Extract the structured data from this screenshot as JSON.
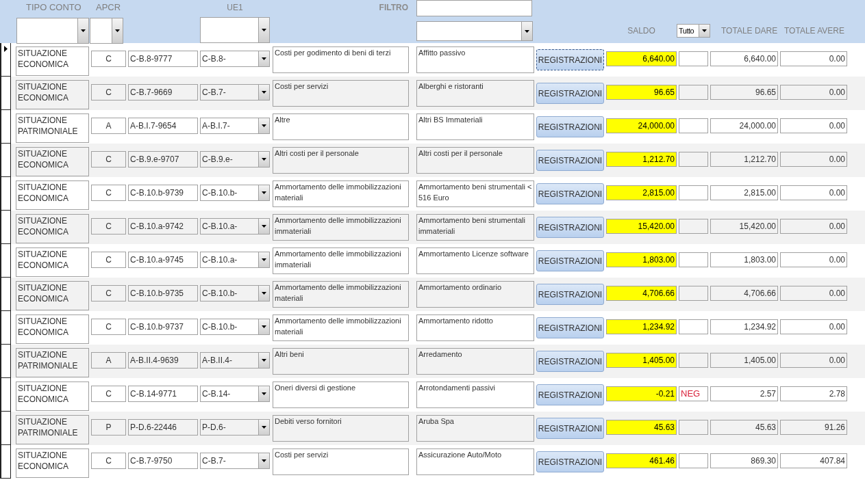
{
  "header": {
    "labels": {
      "tipo_conto": "TIPO CONTO",
      "apcr": "APCR",
      "ue1": "UE1",
      "filtro": "FILTRO",
      "saldo": "SALDO",
      "totale_dare": "TOTALE DARE",
      "totale_avere": "TOTALE AVERE"
    },
    "saldo_filter": "Tutto"
  },
  "rows": [
    {
      "tipo_conto": "SITUAZIONE ECONOMICA",
      "apcr": "C",
      "codice": "C-B.8-9777",
      "ue1": "C-B.8-",
      "descrizione": "Costi per godimento di beni di terzi",
      "sottoconto": "Affitto passivo",
      "button": "REGISTRAZIONI",
      "saldo": "6,640.00",
      "totale_dare": "6,640.00",
      "totale_avere": "0.00",
      "current": true
    },
    {
      "tipo_conto": "SITUAZIONE ECONOMICA",
      "apcr": "C",
      "codice": "C-B.7-9669",
      "ue1": "C-B.7-",
      "descrizione": "Costi per servizi",
      "sottoconto": "Alberghi e ristoranti",
      "button": "REGISTRAZIONI",
      "saldo": "96.65",
      "totale_dare": "96.65",
      "totale_avere": "0.00",
      "current": false
    },
    {
      "tipo_conto": "SITUAZIONE PATRIMONIALE",
      "apcr": "A",
      "codice": "A-B.I.7-9654",
      "ue1": "A-B.I.7-",
      "descrizione": "Altre",
      "sottoconto": "Altri BS Immateriali",
      "button": "REGISTRAZIONI",
      "saldo": "24,000.00",
      "totale_dare": "24,000.00",
      "totale_avere": "0.00",
      "current": false
    },
    {
      "tipo_conto": "SITUAZIONE ECONOMICA",
      "apcr": "C",
      "codice": "C-B.9.e-9707",
      "ue1": "C-B.9.e-",
      "descrizione": "Altri costi per il personale",
      "sottoconto": "Altri costi per il personale",
      "button": "REGISTRAZIONI",
      "saldo": "1,212.70",
      "totale_dare": "1,212.70",
      "totale_avere": "0.00",
      "current": false
    },
    {
      "tipo_conto": "SITUAZIONE ECONOMICA",
      "apcr": "C",
      "codice": "C-B.10.b-9739",
      "ue1": "C-B.10.b-",
      "descrizione": "Ammortamento delle immobilizzazioni materiali",
      "sottoconto": "Ammortamento beni strumentali < 516 Euro",
      "button": "REGISTRAZIONI",
      "saldo": "2,815.00",
      "totale_dare": "2,815.00",
      "totale_avere": "0.00",
      "current": false
    },
    {
      "tipo_conto": "SITUAZIONE ECONOMICA",
      "apcr": "C",
      "codice": "C-B.10.a-9742",
      "ue1": "C-B.10.a-",
      "descrizione": "Ammortamento delle immobilizzazioni immateriali",
      "sottoconto": "Ammortamento beni strumentali immateriali",
      "button": "REGISTRAZIONI",
      "saldo": "15,420.00",
      "totale_dare": "15,420.00",
      "totale_avere": "0.00",
      "current": false
    },
    {
      "tipo_conto": "SITUAZIONE ECONOMICA",
      "apcr": "C",
      "codice": "C-B.10.a-9745",
      "ue1": "C-B.10.a-",
      "descrizione": "Ammortamento delle immobilizzazioni immateriali",
      "sottoconto": "Ammortamento Licenze software",
      "button": "REGISTRAZIONI",
      "saldo": "1,803.00",
      "totale_dare": "1,803.00",
      "totale_avere": "0.00",
      "current": false
    },
    {
      "tipo_conto": "SITUAZIONE ECONOMICA",
      "apcr": "C",
      "codice": "C-B.10.b-9735",
      "ue1": "C-B.10.b-",
      "descrizione": "Ammortamento delle immobilizzazioni materiali",
      "sottoconto": "Ammortamento ordinario",
      "button": "REGISTRAZIONI",
      "saldo": "4,706.66",
      "totale_dare": "4,706.66",
      "totale_avere": "0.00",
      "current": false
    },
    {
      "tipo_conto": "SITUAZIONE ECONOMICA",
      "apcr": "C",
      "codice": "C-B.10.b-9737",
      "ue1": "C-B.10.b-",
      "descrizione": "Ammortamento delle immobilizzazioni materiali",
      "sottoconto": "Ammortamento ridotto",
      "button": "REGISTRAZIONI",
      "saldo": "1,234.92",
      "totale_dare": "1,234.92",
      "totale_avere": "0.00",
      "current": false
    },
    {
      "tipo_conto": "SITUAZIONE PATRIMONIALE",
      "apcr": "A",
      "codice": "A-B.II.4-9639",
      "ue1": "A-B.II.4-",
      "descrizione": "Altri beni",
      "sottoconto": "Arredamento",
      "button": "REGISTRAZIONI",
      "saldo": "1,405.00",
      "totale_dare": "1,405.00",
      "totale_avere": "0.00",
      "current": false
    },
    {
      "tipo_conto": "SITUAZIONE ECONOMICA",
      "apcr": "C",
      "codice": "C-B.14-9771",
      "ue1": "C-B.14-",
      "descrizione": "Oneri diversi di gestione",
      "sottoconto": "Arrotondamenti passivi",
      "button": "REGISTRAZIONI",
      "saldo": "-0.21",
      "segno": "NEG",
      "totale_dare": "2.57",
      "totale_avere": "2.78",
      "current": false
    },
    {
      "tipo_conto": "SITUAZIONE PATRIMONIALE",
      "apcr": "P",
      "codice": "P-D.6-22446",
      "ue1": "P-D.6-",
      "descrizione": "Debiti verso fornitori",
      "sottoconto": "Aruba Spa",
      "button": "REGISTRAZIONI",
      "saldo": "45.63",
      "totale_dare": "45.63",
      "totale_avere": "91.26",
      "current": false
    },
    {
      "tipo_conto": "SITUAZIONE ECONOMICA",
      "apcr": "C",
      "codice": "C-B.7-9750",
      "ue1": "C-B.7-",
      "descrizione": "Costi per servizi",
      "sottoconto": "Assicurazione Auto/Moto",
      "button": "REGISTRAZIONI",
      "saldo": "461.46",
      "totale_dare": "869.30",
      "totale_avere": "407.84",
      "current": false
    }
  ]
}
